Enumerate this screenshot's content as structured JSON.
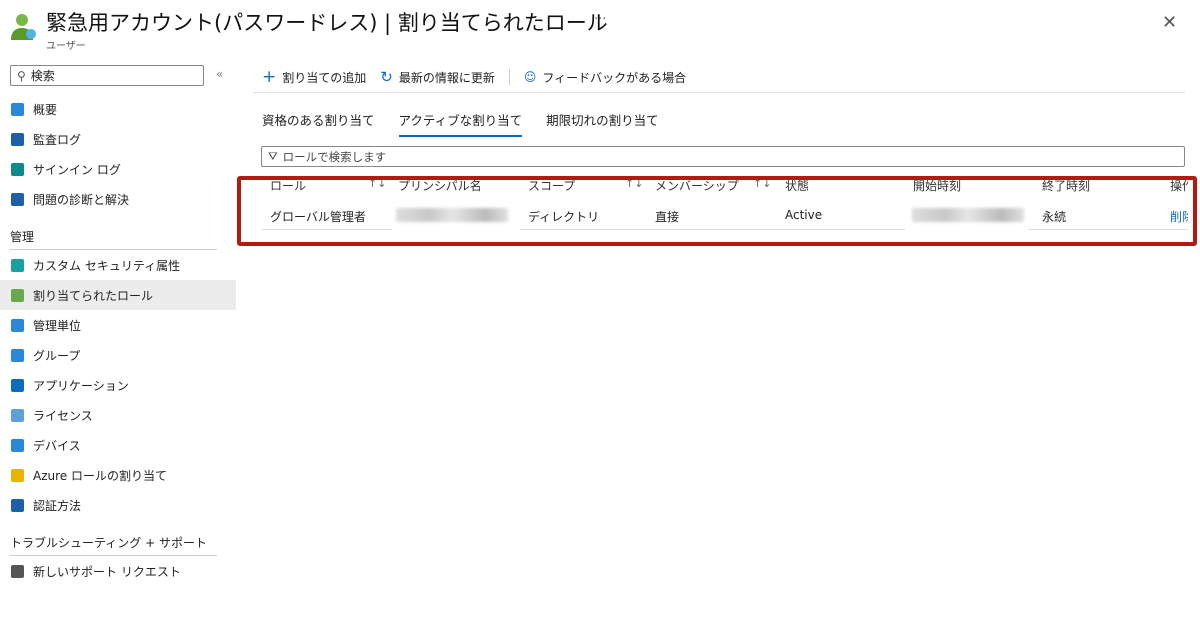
{
  "header": {
    "title": "緊急用アカウント(パスワードレス) | 割り当てられたロール",
    "subtitle": "ユーザー",
    "more": "···",
    "close": "✕"
  },
  "sidebar": {
    "search_placeholder": "検索",
    "collapse": "«",
    "items": [
      {
        "label": "概要",
        "color": "#2b88d8"
      },
      {
        "label": "監査ログ",
        "color": "#1f5fa8"
      },
      {
        "label": "サインイン ログ",
        "color": "#0f8a8a"
      },
      {
        "label": "問題の診断と解決",
        "color": "#1f5fa8"
      }
    ],
    "section_manage": "管理",
    "manage_items": [
      {
        "label": "カスタム セキュリティ属性",
        "color": "#1aa0a0"
      },
      {
        "label": "割り当てられたロール",
        "color": "#6aa84f"
      },
      {
        "label": "管理単位",
        "color": "#2b88d8"
      },
      {
        "label": "グループ",
        "color": "#2b88d8"
      },
      {
        "label": "アプリケーション",
        "color": "#0f6cbd"
      },
      {
        "label": "ライセンス",
        "color": "#5ea0d8"
      },
      {
        "label": "デバイス",
        "color": "#2b88d8"
      },
      {
        "label": "Azure ロールの割り当て",
        "color": "#e8b400"
      },
      {
        "label": "認証方法",
        "color": "#1f5fa8"
      }
    ],
    "section_support": "トラブルシューティング + サポート",
    "support_items": [
      {
        "label": "新しいサポート リクエスト",
        "color": "#555"
      }
    ]
  },
  "toolbar": {
    "add": "割り当ての追加",
    "refresh": "最新の情報に更新",
    "feedback": "フィードバックがある場合"
  },
  "tabs": [
    "資格のある割り当て",
    "アクティブな割り当て",
    "期限切れの割り当て"
  ],
  "filter_placeholder": "ロールで検索します",
  "table": {
    "columns": [
      "ロール",
      "プリンシパル名",
      "スコープ",
      "メンバーシップ",
      "状態",
      "開始時刻",
      "終了時刻",
      "操作"
    ],
    "rows": [
      {
        "role": "グローバル管理者",
        "scope": "ディレクトリ",
        "membership": "直接",
        "state": "Active",
        "end": "永続",
        "action": "削除"
      }
    ]
  },
  "colors": {
    "accent": "#0f6cbd",
    "highlight": "#b51a10"
  }
}
